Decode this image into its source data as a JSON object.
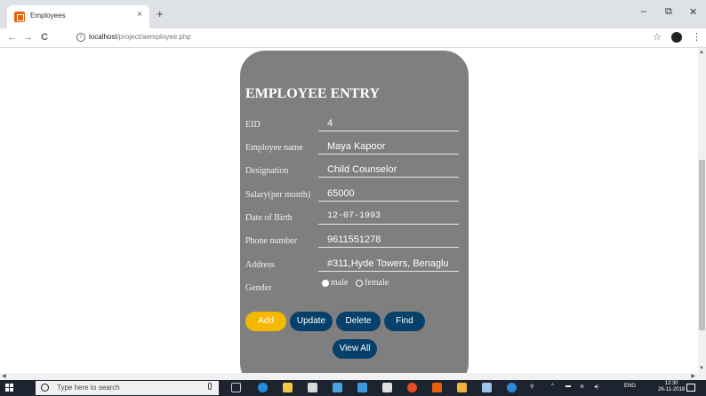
{
  "browser": {
    "tab_title": "Employees",
    "tab_close": "×",
    "new_tab": "+",
    "minimize": "–",
    "maximize": "⧉",
    "close": "✕",
    "back": "←",
    "forward": "→",
    "reload": "C",
    "url_host": "localhost",
    "url_path": "/project/aemployee.php",
    "star": "☆",
    "menu": "⋮"
  },
  "form": {
    "title": "EMPLOYEE ENTRY",
    "fields": [
      {
        "label": "EID",
        "value": "4"
      },
      {
        "label": "Employee name",
        "value": "Maya Kapoor"
      },
      {
        "label": "Designation",
        "value": "Child Counselor"
      },
      {
        "label": "Salary(per month)",
        "value": "65000"
      },
      {
        "label": "Date of Birth",
        "value": "12-07-1993"
      },
      {
        "label": "Phone number",
        "value": "9611551278"
      },
      {
        "label": "Address",
        "value": "#311,Hyde Towers, Benaglu"
      }
    ],
    "gender": {
      "label": "Gender",
      "options": [
        "male",
        "female"
      ],
      "selected": "male"
    },
    "buttons": {
      "add": "Add",
      "update": "Update",
      "delete": "Delete",
      "find": "Find",
      "view_all": "View All"
    },
    "colors": {
      "card": "#7f7f7f",
      "add_button": "#f5b800",
      "action_buttons": "#07416b"
    }
  },
  "taskbar": {
    "search_placeholder": "Type here to search",
    "lang": "ENG",
    "time": "12:30",
    "date": "26-11-2018"
  }
}
